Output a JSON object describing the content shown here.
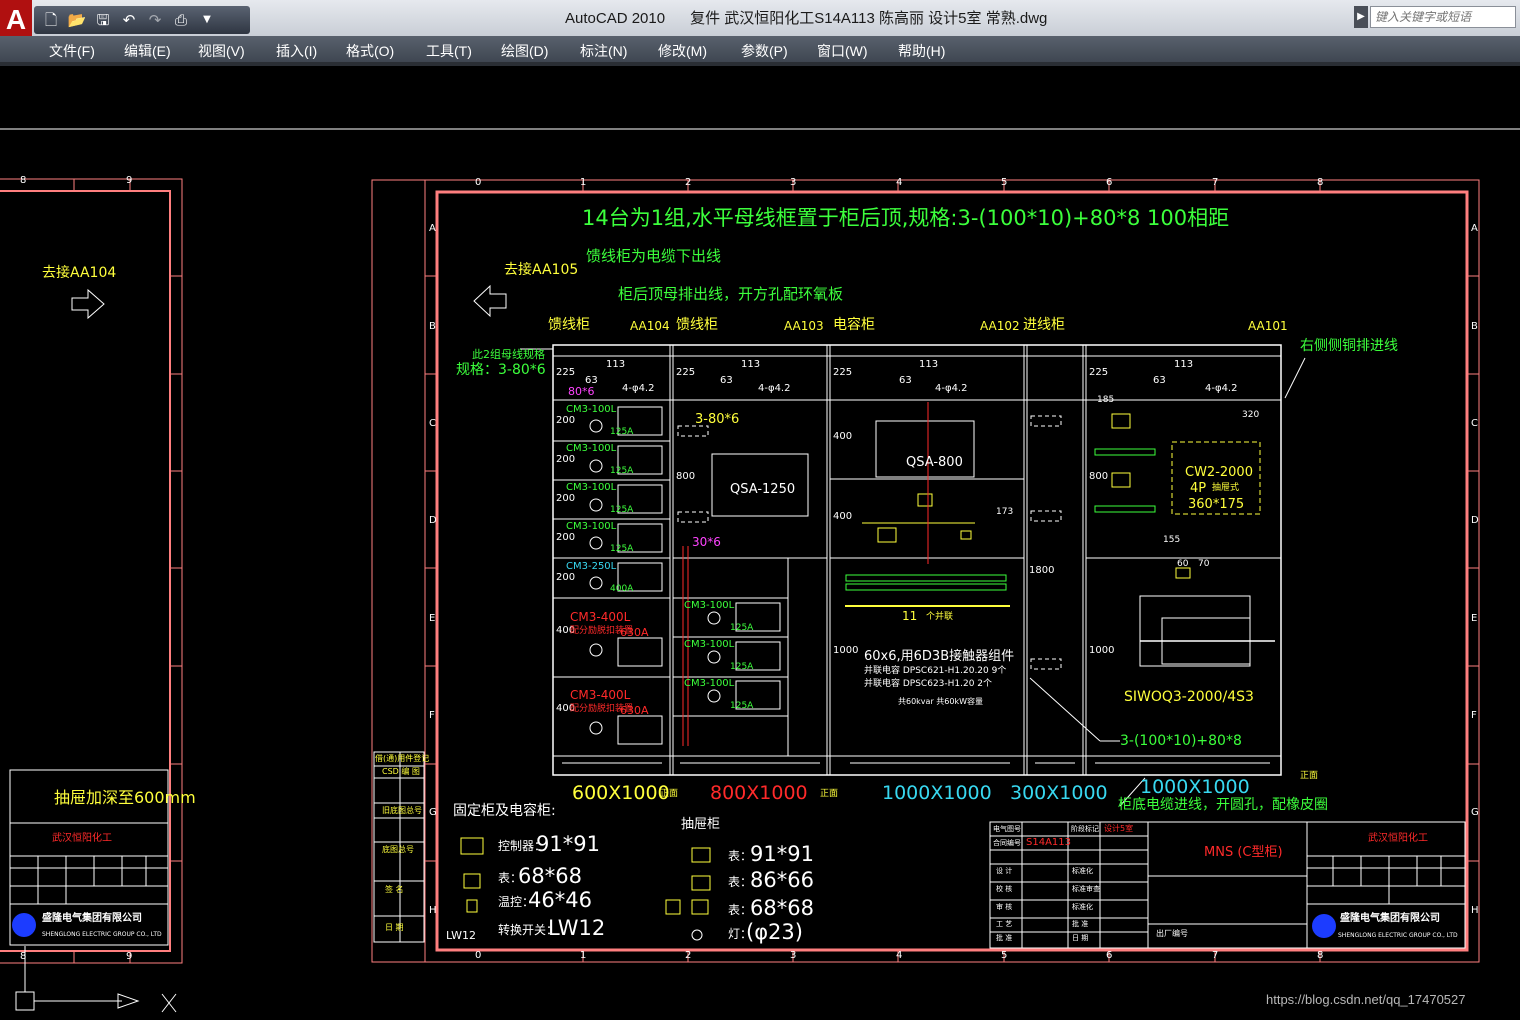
{
  "window": {
    "title": "AutoCAD 2010      复件 武汉恒阳化工S14A113 陈高丽 设计5室 常熟.dwg",
    "search_placeholder": "键入关键字或短语",
    "app_logo": "A"
  },
  "menu": [
    "文件(F)",
    "编辑(E)",
    "视图(V)",
    "插入(I)",
    "格式(O)",
    "工具(T)",
    "绘图(D)",
    "标注(N)",
    "修改(M)",
    "参数(P)",
    "窗口(W)",
    "帮助(H)"
  ],
  "quick_access": [
    "new-icon",
    "open-icon",
    "save-icon",
    "undo-icon",
    "redo-icon",
    "plot-icon",
    "dropdown-icon"
  ],
  "drawing": {
    "grid_cols": [
      "0",
      "1",
      "2",
      "3",
      "4",
      "5",
      "6",
      "7",
      "8"
    ],
    "grid_rows": [
      "A",
      "B",
      "C",
      "D",
      "E",
      "F",
      "G",
      "H"
    ],
    "left_sheet_cols": [
      "8",
      "9"
    ],
    "top_note": "14台为1组,水平母线框置于柜后顶,规格:3-(100*10)+80*8    100相距",
    "note_feeder": "馈线柜为电缆下出线",
    "note_back": "柜后顶母排出线，开方孔配环氧板",
    "left_arrow_label": "去接AA105",
    "left_sheet_arrow_label": "去接AA104",
    "cabinet_types": [
      "馈线柜",
      "馈线柜",
      "电容柜",
      "进线柜"
    ],
    "cabinet_ids": [
      "AA104",
      "AA103",
      "AA102",
      "AA101"
    ],
    "note_right_bus": "右侧侧铜排进线",
    "note_group": "此2组母线规格",
    "note_group_spec": "规格：3-80*6",
    "note_80x6": "80*6",
    "note_3_80x6": "3-80*6",
    "note_30x6": "30*6",
    "dim_113": "113",
    "dim_63": "63",
    "dim_4_phi42": "4-φ4.2",
    "dim_225": "225",
    "dim_200": "200",
    "dim_400": "400",
    "dim_800": "800",
    "dim_1000": "1000",
    "dim_1800": "1800",
    "breakers_a": [
      "CM3-100L",
      "CM3-100L",
      "CM3-100L",
      "CM3-100L",
      "CM3-250L"
    ],
    "breaker_ratings_a": [
      "125A",
      "125A",
      "125A",
      "125A",
      "400A"
    ],
    "breakers_red": [
      "CM3-400L",
      "CM3-400L"
    ],
    "breaker_red_note": "配分励脱扣装置",
    "breaker_red_rating": "630A",
    "breakers_b": [
      "CM3-100L",
      "CM3-100L",
      "CM3-100L"
    ],
    "breaker_ratings_b": [
      "125A",
      "125A",
      "125A"
    ],
    "qsa1250": "QSA-1250",
    "qsa800": "QSA-800",
    "cw2_line1": "CW2-2000",
    "cw2_line2": "4P",
    "cw2_line3": "360*175",
    "cw2_flag": "抽屉式",
    "capacitor_count": "11",
    "capacitor_unit": "个并联",
    "capacitor_spec": "60x6,用6D3B接触器组件",
    "capacitor_sub1": "并联电容 DPSC621-H1.20.20    9个",
    "capacitor_sub2": "并联电容 DPSC623-H1.20    2个",
    "capacitor_sub3": "共60kvar 共60kW容量",
    "siwoq": "SIWOQ3-2000/4S3",
    "bus_spec": "3-(100*10)+80*8",
    "dim_320": "320",
    "dim_185": "185",
    "dim_155": "155",
    "dim_60": "60",
    "dim_70": "70",
    "dim_173": "173",
    "dims_bottom": [
      "600X1000",
      "800X1000",
      "1000X1000",
      "300X1000",
      "1000X1000"
    ],
    "dim_suffix": "正面",
    "note_bottom_open": "柜底电缆进线，开圆孔，配橡皮圈",
    "legend_fixed_title": "固定柜及电容柜:",
    "legend_fixed": [
      {
        "label": "控制器：",
        "value": "91*91"
      },
      {
        "label": "表：",
        "value": "68*68"
      },
      {
        "label": "温控：",
        "value": "46*46"
      },
      {
        "label": "转换开关：",
        "value": "LW12"
      }
    ],
    "legend_draw_title": "抽屉柜",
    "legend_draw": [
      {
        "label": "表：",
        "value": "91*91"
      },
      {
        "label": "表：",
        "value": "86*66"
      },
      {
        "label": "表：",
        "value": "68*68"
      },
      {
        "label": "灯：",
        "value": "(φ23)"
      }
    ],
    "legend_lw12": "LW12",
    "extra_mark": "正面",
    "left_panel_cells": [
      "借(通)用件登记",
      "CSD 编 图",
      "旧底图总号",
      "底图总号",
      "签 名",
      "日 期"
    ],
    "title_block": {
      "drawing_no_label": "电气图号",
      "drawing_no": "S14A113",
      "project_label": "合同编号",
      "stage_label": "阶段标记",
      "stage": "设计5室",
      "product": "MNS (C型柜)",
      "company": "武汉恒阳化工",
      "rows": [
        "设 计",
        "校 核",
        "审 核",
        "工 艺",
        "批 准"
      ],
      "rows_mid": [
        "标准化",
        "标准审查",
        "标准化",
        "批 准",
        "日 期"
      ],
      "factory_no": "出厂编号",
      "logo_name": "盛隆电气集团有限公司",
      "logo_en": "SHENGLONG ELECTRIC GROUP CO., LTD"
    },
    "left_sheet_note": "抽屉加深至600mm",
    "left_sheet_company": "武汉恒阳化工",
    "left_sheet_logo_name": "盛隆电气集团有限公司",
    "left_sheet_logo_en": "SHENGLONG ELECTRIC GROUP CO., LTD"
  },
  "watermark": "https://blog.csdn.net/qq_17470527"
}
